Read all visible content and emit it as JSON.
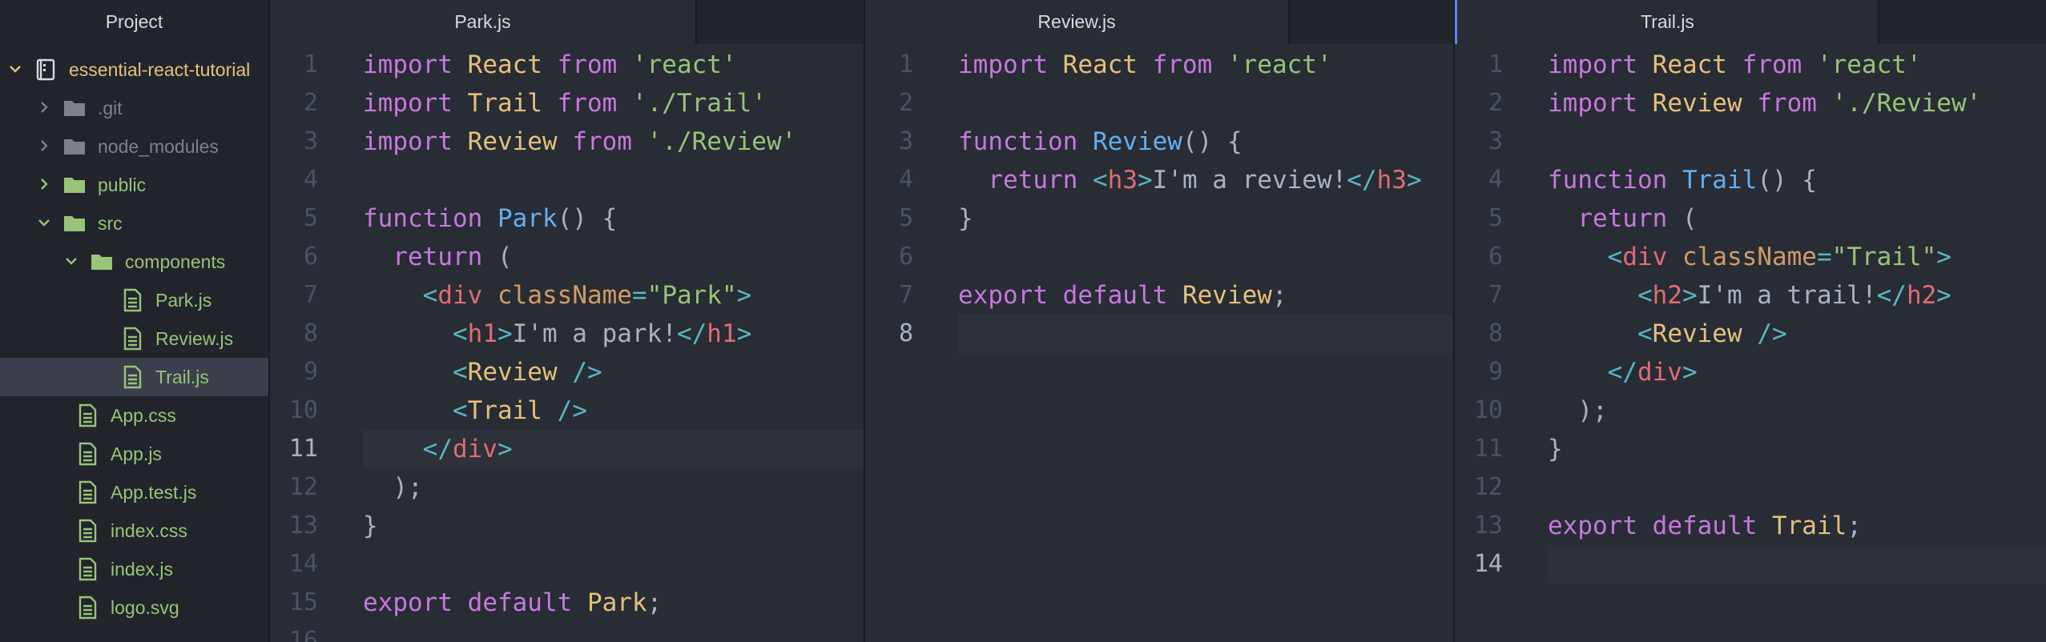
{
  "sidebar": {
    "header": "Project",
    "tree": [
      {
        "label": "essential-react-tutorial",
        "type": "repo",
        "chevron": "down",
        "color": "gold",
        "depth": 0
      },
      {
        "label": ".git",
        "type": "folder",
        "chevron": "right",
        "color": "gray",
        "depth": 1
      },
      {
        "label": "node_modules",
        "type": "folder",
        "chevron": "right",
        "color": "gray",
        "depth": 1
      },
      {
        "label": "public",
        "type": "folder",
        "chevron": "right",
        "color": "green",
        "depth": 1
      },
      {
        "label": "src",
        "type": "folder",
        "chevron": "down",
        "color": "green",
        "depth": 1
      },
      {
        "label": "components",
        "type": "folder",
        "chevron": "down",
        "color": "green",
        "depth": 2
      },
      {
        "label": "Park.js",
        "type": "file",
        "chevron": "",
        "color": "green",
        "depth": 3
      },
      {
        "label": "Review.js",
        "type": "file",
        "chevron": "",
        "color": "green",
        "depth": 3
      },
      {
        "label": "Trail.js",
        "type": "file",
        "chevron": "",
        "color": "green",
        "depth": 3,
        "selected": true
      },
      {
        "label": "App.css",
        "type": "file",
        "chevron": "",
        "color": "green",
        "depth": 2
      },
      {
        "label": "App.js",
        "type": "file",
        "chevron": "",
        "color": "green",
        "depth": 2
      },
      {
        "label": "App.test.js",
        "type": "file",
        "chevron": "",
        "color": "green",
        "depth": 2
      },
      {
        "label": "index.css",
        "type": "file",
        "chevron": "",
        "color": "green",
        "depth": 2
      },
      {
        "label": "index.js",
        "type": "file",
        "chevron": "",
        "color": "green",
        "depth": 2
      },
      {
        "label": "logo.svg",
        "type": "file",
        "chevron": "",
        "color": "green",
        "depth": 2
      }
    ]
  },
  "panes": [
    {
      "tab": "Park.js",
      "cursor_line": 11,
      "lines": [
        [
          [
            "kw",
            "import"
          ],
          [
            "pl",
            " "
          ],
          [
            "id",
            "React"
          ],
          [
            "pl",
            " "
          ],
          [
            "kw",
            "from"
          ],
          [
            "pl",
            " "
          ],
          [
            "str",
            "'react'"
          ]
        ],
        [
          [
            "kw",
            "import"
          ],
          [
            "pl",
            " "
          ],
          [
            "id",
            "Trail"
          ],
          [
            "pl",
            " "
          ],
          [
            "kw",
            "from"
          ],
          [
            "pl",
            " "
          ],
          [
            "str",
            "'./Trail'"
          ]
        ],
        [
          [
            "kw",
            "import"
          ],
          [
            "pl",
            " "
          ],
          [
            "id",
            "Review"
          ],
          [
            "pl",
            " "
          ],
          [
            "kw",
            "from"
          ],
          [
            "pl",
            " "
          ],
          [
            "str",
            "'./Review'"
          ]
        ],
        [],
        [
          [
            "kw",
            "function"
          ],
          [
            "pl",
            " "
          ],
          [
            "fn",
            "Park"
          ],
          [
            "pl",
            "() {"
          ]
        ],
        [
          [
            "pl",
            "  "
          ],
          [
            "kw",
            "return"
          ],
          [
            "pl",
            " ("
          ]
        ],
        [
          [
            "pl",
            "    "
          ],
          [
            "pn",
            "<"
          ],
          [
            "tg",
            "div"
          ],
          [
            "pl",
            " "
          ],
          [
            "at",
            "className"
          ],
          [
            "pn",
            "="
          ],
          [
            "str",
            "\"Park\""
          ],
          [
            "pn",
            ">"
          ]
        ],
        [
          [
            "pl",
            "      "
          ],
          [
            "pn",
            "<"
          ],
          [
            "tg",
            "h1"
          ],
          [
            "pn",
            ">"
          ],
          [
            "pl",
            "I'm a park!"
          ],
          [
            "pn",
            "</"
          ],
          [
            "tg",
            "h1"
          ],
          [
            "pn",
            ">"
          ]
        ],
        [
          [
            "pl",
            "      "
          ],
          [
            "pn",
            "<"
          ],
          [
            "id",
            "Review"
          ],
          [
            "pl",
            " "
          ],
          [
            "pn",
            "/>"
          ]
        ],
        [
          [
            "pl",
            "      "
          ],
          [
            "pn",
            "<"
          ],
          [
            "id",
            "Trail"
          ],
          [
            "pl",
            " "
          ],
          [
            "pn",
            "/>"
          ]
        ],
        [
          [
            "pl",
            "    "
          ],
          [
            "pn",
            "</"
          ],
          [
            "tg",
            "div"
          ],
          [
            "pn",
            ">"
          ]
        ],
        [
          [
            "pl",
            "  );"
          ]
        ],
        [
          [
            "pl",
            "}"
          ]
        ],
        [],
        [
          [
            "kw",
            "export"
          ],
          [
            "pl",
            " "
          ],
          [
            "kw",
            "default"
          ],
          [
            "pl",
            " "
          ],
          [
            "id",
            "Park"
          ],
          [
            "pl",
            ";"
          ]
        ],
        []
      ]
    },
    {
      "tab": "Review.js",
      "cursor_line": 8,
      "lines": [
        [
          [
            "kw",
            "import"
          ],
          [
            "pl",
            " "
          ],
          [
            "id",
            "React"
          ],
          [
            "pl",
            " "
          ],
          [
            "kw",
            "from"
          ],
          [
            "pl",
            " "
          ],
          [
            "str",
            "'react'"
          ]
        ],
        [],
        [
          [
            "kw",
            "function"
          ],
          [
            "pl",
            " "
          ],
          [
            "fn",
            "Review"
          ],
          [
            "pl",
            "() {"
          ]
        ],
        [
          [
            "pl",
            "  "
          ],
          [
            "kw",
            "return"
          ],
          [
            "pl",
            " "
          ],
          [
            "pn",
            "<"
          ],
          [
            "tg",
            "h3"
          ],
          [
            "pn",
            ">"
          ],
          [
            "pl",
            "I'm a review!"
          ],
          [
            "pn",
            "</"
          ],
          [
            "tg",
            "h3"
          ],
          [
            "pn",
            ">"
          ]
        ],
        [
          [
            "pl",
            "}"
          ]
        ],
        [],
        [
          [
            "kw",
            "export"
          ],
          [
            "pl",
            " "
          ],
          [
            "kw",
            "default"
          ],
          [
            "pl",
            " "
          ],
          [
            "id",
            "Review"
          ],
          [
            "pl",
            ";"
          ]
        ],
        []
      ]
    },
    {
      "tab": "Trail.js",
      "cursor_line": 14,
      "lines": [
        [
          [
            "kw",
            "import"
          ],
          [
            "pl",
            " "
          ],
          [
            "id",
            "React"
          ],
          [
            "pl",
            " "
          ],
          [
            "kw",
            "from"
          ],
          [
            "pl",
            " "
          ],
          [
            "str",
            "'react'"
          ]
        ],
        [
          [
            "kw",
            "import"
          ],
          [
            "pl",
            " "
          ],
          [
            "id",
            "Review"
          ],
          [
            "pl",
            " "
          ],
          [
            "kw",
            "from"
          ],
          [
            "pl",
            " "
          ],
          [
            "str",
            "'./Review'"
          ]
        ],
        [],
        [
          [
            "kw",
            "function"
          ],
          [
            "pl",
            " "
          ],
          [
            "fn",
            "Trail"
          ],
          [
            "pl",
            "() {"
          ]
        ],
        [
          [
            "pl",
            "  "
          ],
          [
            "kw",
            "return"
          ],
          [
            "pl",
            " ("
          ]
        ],
        [
          [
            "pl",
            "    "
          ],
          [
            "pn",
            "<"
          ],
          [
            "tg",
            "div"
          ],
          [
            "pl",
            " "
          ],
          [
            "at",
            "className"
          ],
          [
            "pn",
            "="
          ],
          [
            "str",
            "\"Trail\""
          ],
          [
            "pn",
            ">"
          ]
        ],
        [
          [
            "pl",
            "      "
          ],
          [
            "pn",
            "<"
          ],
          [
            "tg",
            "h2"
          ],
          [
            "pn",
            ">"
          ],
          [
            "pl",
            "I'm a trail!"
          ],
          [
            "pn",
            "</"
          ],
          [
            "tg",
            "h2"
          ],
          [
            "pn",
            ">"
          ]
        ],
        [
          [
            "pl",
            "      "
          ],
          [
            "pn",
            "<"
          ],
          [
            "id",
            "Review"
          ],
          [
            "pl",
            " "
          ],
          [
            "pn",
            "/>"
          ]
        ],
        [
          [
            "pl",
            "    "
          ],
          [
            "pn",
            "</"
          ],
          [
            "tg",
            "div"
          ],
          [
            "pn",
            ">"
          ]
        ],
        [
          [
            "pl",
            "  );"
          ]
        ],
        [
          [
            "pl",
            "}"
          ]
        ],
        [],
        [
          [
            "kw",
            "export"
          ],
          [
            "pl",
            " "
          ],
          [
            "kw",
            "default"
          ],
          [
            "pl",
            " "
          ],
          [
            "id",
            "Trail"
          ],
          [
            "pl",
            ";"
          ]
        ],
        []
      ]
    }
  ],
  "colors": {
    "background": "#282c34",
    "sidebar": "#21252b",
    "keyword": "#c678dd",
    "identifier": "#e5c07b",
    "string": "#98c379",
    "function": "#61afef",
    "tag": "#e06c75",
    "punctuation": "#56b6c2",
    "focus_accent": "#568af2"
  }
}
